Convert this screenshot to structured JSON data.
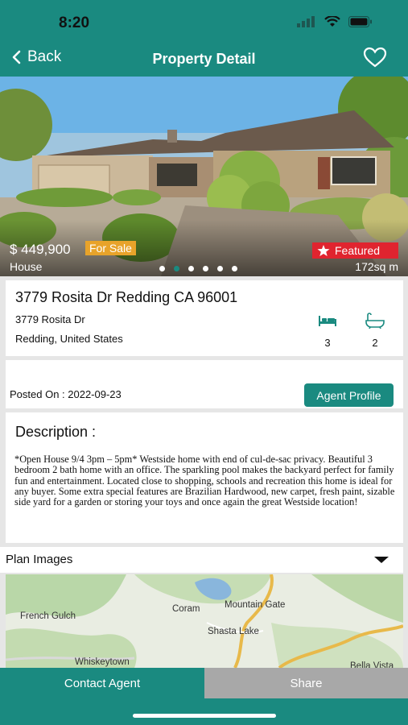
{
  "status_bar": {
    "time": "8:20"
  },
  "nav": {
    "back_label": "Back",
    "title": "Property Detail"
  },
  "hero": {
    "price": "$ 449,900",
    "status_badge": "For Sale",
    "property_type": "House",
    "featured_label": "Featured",
    "area": "172sq m",
    "slide_count": 6,
    "active_slide": 2
  },
  "address": {
    "title": "3779 Rosita Dr Redding CA 96001",
    "line1": "3779 Rosita Dr",
    "line2": "Redding, United States",
    "bedrooms": "3",
    "bathrooms": "2"
  },
  "posting": {
    "posted_on": "Posted On : 2022-09-23",
    "agent_button": "Agent Profile"
  },
  "description": {
    "heading": "Description :",
    "body": "*Open House 9/4 3pm – 5pm* Westside home with end of cul-de-sac privacy. Beautiful 3 bedroom 2 bath home with an office. The sparkling pool makes the backyard perfect for family fun and entertainment. Located close to shopping, schools and recreation this home is ideal for any buyer. Some extra special features are Brazilian Hardwood, new carpet, fresh paint, sizable side yard for a garden or storing your toys and once again the great Westside location!"
  },
  "plan": {
    "label": "Plan Images"
  },
  "map": {
    "places": [
      "French Gulch",
      "Coram",
      "Mountain Gate",
      "Shasta Lake",
      "Whiskeytown",
      "Bella Vista"
    ]
  },
  "actions": {
    "contact": "Contact Agent",
    "share": "Share"
  },
  "colors": {
    "primary": "#1a8a80",
    "featured": "#e0242f",
    "for_sale": "#e8a32a",
    "share_bg": "#a8a8a8"
  }
}
